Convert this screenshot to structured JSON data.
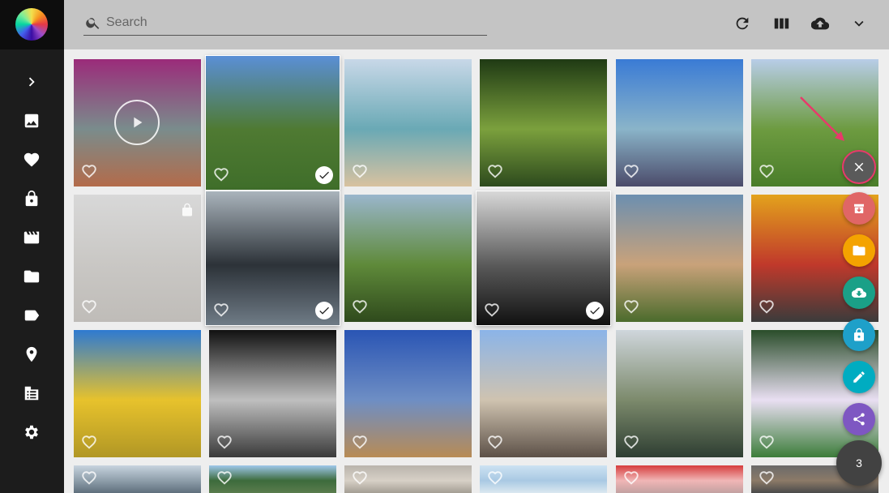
{
  "search": {
    "placeholder": "Search"
  },
  "sidebar": {
    "items": [
      {
        "name": "expand",
        "icon": "chevron-right-icon"
      },
      {
        "name": "photos",
        "icon": "image-icon"
      },
      {
        "name": "favorites",
        "icon": "heart-icon"
      },
      {
        "name": "private",
        "icon": "lock-icon"
      },
      {
        "name": "videos",
        "icon": "movie-icon"
      },
      {
        "name": "albums",
        "icon": "folder-icon"
      },
      {
        "name": "labels",
        "icon": "label-icon"
      },
      {
        "name": "places",
        "icon": "place-icon"
      },
      {
        "name": "library",
        "icon": "library-icon"
      },
      {
        "name": "settings",
        "icon": "gear-icon"
      }
    ]
  },
  "toolbar": {
    "buttons": [
      "refresh-icon",
      "view-columns-icon",
      "upload-cloud-icon",
      "chevron-down-icon"
    ]
  },
  "actions": {
    "close": {
      "icon": "close-icon",
      "color": "#5a5a5a",
      "ring": "#e8396b"
    },
    "buttons": [
      {
        "name": "archive",
        "icon": "archive-icon",
        "color": "#e06666"
      },
      {
        "name": "album",
        "icon": "folder-icon",
        "color": "#f4a300"
      },
      {
        "name": "download",
        "icon": "cloud-download-icon",
        "color": "#1aa087"
      },
      {
        "name": "private",
        "icon": "lock-icon",
        "color": "#1ea0c9"
      },
      {
        "name": "edit",
        "icon": "pencil-icon",
        "color": "#00acc1"
      },
      {
        "name": "share",
        "icon": "share-icon",
        "color": "#7e57c2"
      }
    ],
    "selection_count": "3"
  },
  "photos": [
    {
      "name": "gopher-plush",
      "video": true,
      "selected": false,
      "private": false,
      "colors": [
        "#9b2b7a",
        "#7a8c8c",
        "#b36b4a"
      ]
    },
    {
      "name": "orchard-trees",
      "selected": true,
      "private": false,
      "colors": [
        "#5a8fd6",
        "#4f7a32",
        "#3f6e2a"
      ]
    },
    {
      "name": "beach-rocks",
      "selected": false,
      "private": false,
      "colors": [
        "#c8d8e8",
        "#6aa9b5",
        "#d8c2a0"
      ]
    },
    {
      "name": "forest-sunlight",
      "selected": false,
      "private": false,
      "colors": [
        "#1f3a14",
        "#7ba03d",
        "#2d4a1d"
      ]
    },
    {
      "name": "painted-silos-truck",
      "selected": false,
      "private": false,
      "colors": [
        "#3a7bd5",
        "#8ab4c9",
        "#4b4b6a"
      ]
    },
    {
      "name": "green-hill-sky",
      "selected": false,
      "private": false,
      "colors": [
        "#b8cde8",
        "#6d9b40",
        "#4a7d2a"
      ]
    },
    {
      "name": "cockroach-floor",
      "selected": false,
      "private": true,
      "colors": [
        "#d8d8d8",
        "#c9c7c4",
        "#bfbcb8"
      ]
    },
    {
      "name": "dome-interior",
      "selected": true,
      "private": false,
      "colors": [
        "#aab4bc",
        "#2c3238",
        "#6f7b86"
      ]
    },
    {
      "name": "water-buffalo-field",
      "selected": false,
      "private": false,
      "colors": [
        "#9ab6cc",
        "#5f8a3a",
        "#2f4a1c"
      ]
    },
    {
      "name": "castle-silhouette",
      "selected": true,
      "private": false,
      "colors": [
        "#d8d8d8",
        "#5a5a5a",
        "#111111"
      ]
    },
    {
      "name": "cow-meadow",
      "selected": false,
      "private": false,
      "colors": [
        "#6c8fb0",
        "#c9a27a",
        "#4b6b2c"
      ]
    },
    {
      "name": "graffiti-train",
      "selected": false,
      "private": false,
      "colors": [
        "#e3a21c",
        "#c0392b",
        "#3b3b3b"
      ]
    },
    {
      "name": "yellow-flowers",
      "selected": false,
      "private": false,
      "colors": [
        "#2e7ad1",
        "#e7c22c",
        "#b19725"
      ]
    },
    {
      "name": "window-bw",
      "selected": false,
      "private": false,
      "colors": [
        "#111111",
        "#bfbfbf",
        "#3a3a3a"
      ]
    },
    {
      "name": "barbed-wire",
      "selected": false,
      "private": false,
      "colors": [
        "#2a55b4",
        "#6e8ec4",
        "#b88b55"
      ]
    },
    {
      "name": "penguin-beach",
      "selected": false,
      "private": false,
      "colors": [
        "#8bb4e8",
        "#cfc3b0",
        "#5d5148"
      ]
    },
    {
      "name": "swamp-reflection",
      "selected": false,
      "private": false,
      "colors": [
        "#cfd6dc",
        "#7c8a6c",
        "#2e3e32"
      ]
    },
    {
      "name": "water-lily",
      "selected": false,
      "private": false,
      "colors": [
        "#2a4d2a",
        "#e9dff2",
        "#3c7d3a"
      ]
    },
    {
      "name": "glass-roof",
      "selected": false,
      "private": false,
      "colors": [
        "#c7d3de",
        "#8e9eaa",
        "#5f6f7c"
      ]
    },
    {
      "name": "mountain-peak",
      "selected": false,
      "private": false,
      "colors": [
        "#9ec7ea",
        "#3d6b3c",
        "#5a7c4d"
      ]
    },
    {
      "name": "soft-sky",
      "selected": false,
      "private": false,
      "colors": [
        "#b9b4ad",
        "#d7d0c6",
        "#a49e94"
      ]
    },
    {
      "name": "pale-sky",
      "selected": false,
      "private": false,
      "colors": [
        "#cde2f2",
        "#a9c9e3",
        "#dbe8f0"
      ]
    },
    {
      "name": "red-frame",
      "selected": false,
      "private": false,
      "colors": [
        "#d63d3d",
        "#f0b6b6",
        "#c2a1a1"
      ]
    },
    {
      "name": "cat-window",
      "selected": false,
      "private": false,
      "colors": [
        "#6a6a6a",
        "#8c7a68",
        "#4a4a4a"
      ]
    }
  ]
}
